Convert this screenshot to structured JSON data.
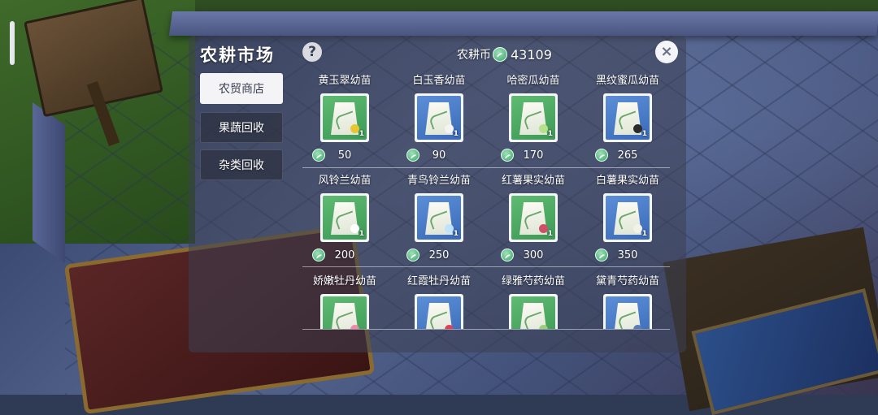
{
  "header": {
    "title": "农耕市场",
    "help_icon": "?",
    "currency_label": "农耕币",
    "currency_amount": "43109",
    "close_icon": "×"
  },
  "tabs": [
    {
      "label": "农贸商店",
      "active": true
    },
    {
      "label": "果蔬回收",
      "active": false
    },
    {
      "label": "杂类回收",
      "active": false
    }
  ],
  "items": [
    {
      "name": "黄玉翠幼苗",
      "price": "50",
      "qty": "1",
      "pack": "green",
      "fruit_color": "#e8c630"
    },
    {
      "name": "白玉香幼苗",
      "price": "90",
      "qty": "1",
      "pack": "blue",
      "fruit_color": "#f4f4f4"
    },
    {
      "name": "哈密瓜幼苗",
      "price": "170",
      "qty": "1",
      "pack": "green",
      "fruit_color": "#b6e08a"
    },
    {
      "name": "黑纹蜜瓜幼苗",
      "price": "265",
      "qty": "1",
      "pack": "blue",
      "fruit_color": "#2c2c2c"
    },
    {
      "name": "风铃兰幼苗",
      "price": "200",
      "qty": "1",
      "pack": "green",
      "fruit_color": "#ffffff"
    },
    {
      "name": "青鸟铃兰幼苗",
      "price": "250",
      "qty": "1",
      "pack": "blue",
      "fruit_color": "#bfe3ff"
    },
    {
      "name": "红薯果实幼苗",
      "price": "300",
      "qty": "1",
      "pack": "green",
      "fruit_color": "#d0506a"
    },
    {
      "name": "白薯果实幼苗",
      "price": "350",
      "qty": "1",
      "pack": "blue",
      "fruit_color": "#f2f2e8"
    },
    {
      "name": "娇嫩牡丹幼苗",
      "price": "",
      "qty": "",
      "pack": "green",
      "fruit_color": "#f08aa8"
    },
    {
      "name": "红霞牡丹幼苗",
      "price": "",
      "qty": "",
      "pack": "blue",
      "fruit_color": "#e0405a"
    },
    {
      "name": "绿雅芍药幼苗",
      "price": "",
      "qty": "",
      "pack": "green",
      "fruit_color": "#9ad07a"
    },
    {
      "name": "黛青芍药幼苗",
      "price": "",
      "qty": "",
      "pack": "blue",
      "fruit_color": "#5a7ab8"
    }
  ],
  "colors": {
    "coin": "#3aa86a",
    "pack_green": "#4fae64",
    "pack_blue": "#4a7cc8"
  }
}
